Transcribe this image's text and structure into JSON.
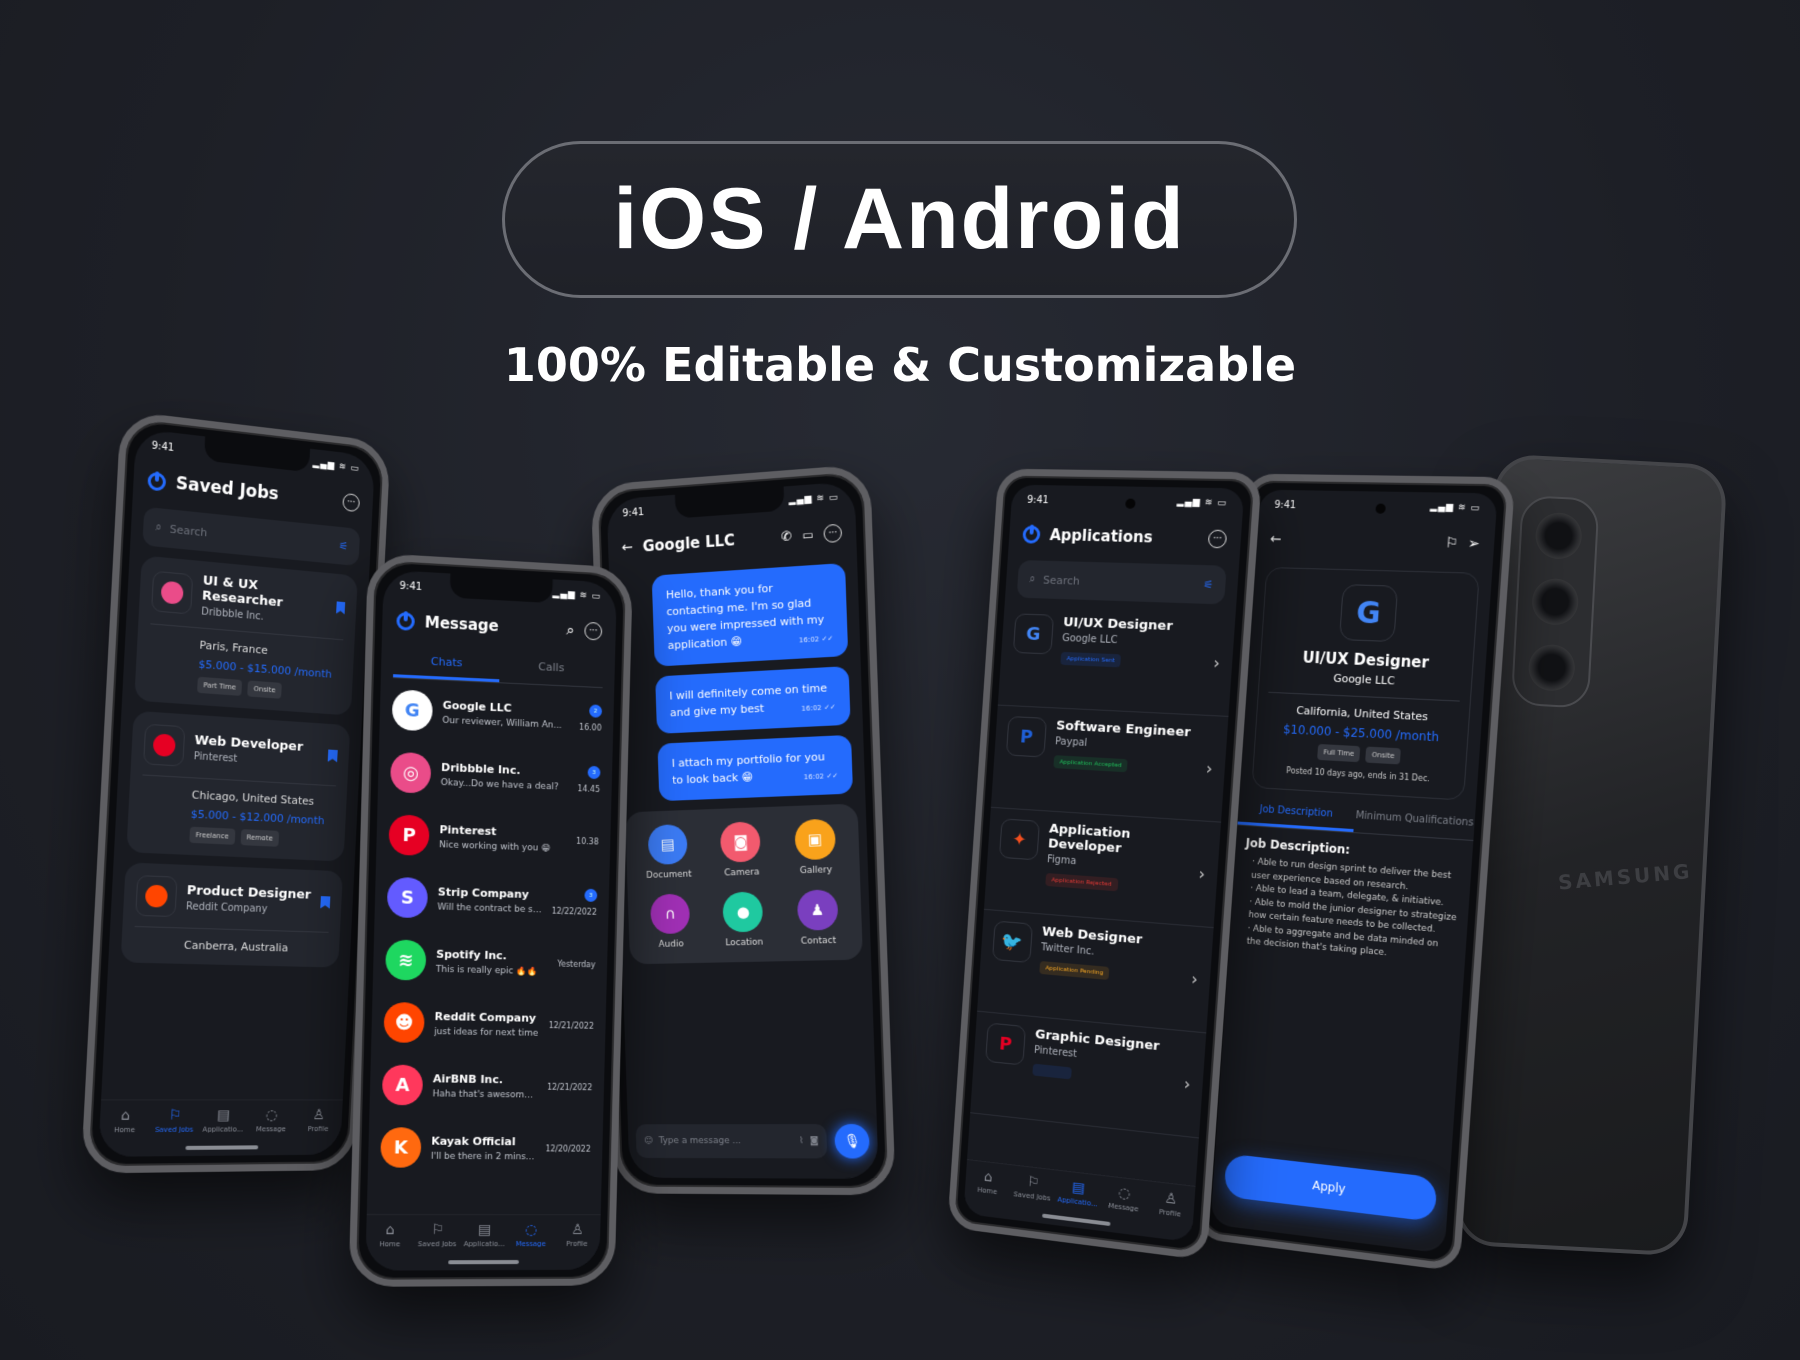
{
  "hero": {
    "title": "iOS / Android",
    "subtitle": "100% Editable & Customizable"
  },
  "colors": {
    "accent": "#246bfd",
    "background": "#1d1f26",
    "card": "#23262e"
  },
  "saved_jobs": {
    "time": "9:41",
    "title": "Saved Jobs",
    "search_placeholder": "Search",
    "jobs": [
      {
        "title": "UI & UX Researcher",
        "company": "Dribbble Inc.",
        "location": "Paris, France",
        "salary": "$5.000 - $15.000 /month",
        "tags": [
          "Part Time",
          "Onsite"
        ],
        "logo_color": "#ea4c89",
        "logo_icon": "dribbble-icon"
      },
      {
        "title": "Web Developer",
        "company": "Pinterest",
        "location": "Chicago, United States",
        "salary": "$5.000 - $12.000 /month",
        "tags": [
          "Freelance",
          "Remote"
        ],
        "logo_color": "#e60023",
        "logo_icon": "pinterest-icon"
      },
      {
        "title": "Product Designer",
        "company": "Reddit Company",
        "location": "Canberra, Australia",
        "salary": "",
        "tags": [],
        "logo_color": "#ff4500",
        "logo_icon": "reddit-icon"
      }
    ],
    "nav": [
      "Home",
      "Saved Jobs",
      "Applicatio...",
      "Message",
      "Profile"
    ],
    "nav_active": 1
  },
  "message": {
    "time": "9:41",
    "title": "Message",
    "tabs": [
      "Chats",
      "Calls"
    ],
    "chats": [
      {
        "name": "Google LLC",
        "preview": "Our reviewer, William An...",
        "time": "16.00",
        "badge": "2",
        "color": "#ffffff",
        "letter": "G"
      },
      {
        "name": "Dribbble Inc.",
        "preview": "Okay...Do we have a deal?",
        "time": "14.45",
        "badge": "3",
        "color": "#ea4c89",
        "letter": "◎"
      },
      {
        "name": "Pinterest",
        "preview": "Nice working with you 😁",
        "time": "10.38",
        "badge": "",
        "color": "#e60023",
        "letter": "P"
      },
      {
        "name": "Strip Company",
        "preview": "Will the contract be sent?",
        "time": "12/22/2022",
        "badge": "3",
        "color": "#635bff",
        "letter": "S"
      },
      {
        "name": "Spotify Inc.",
        "preview": "This is really epic 🔥🔥",
        "time": "Yesterday",
        "badge": "",
        "color": "#1ed760",
        "letter": "≋"
      },
      {
        "name": "Reddit Company",
        "preview": "just ideas for next time",
        "time": "12/21/2022",
        "badge": "",
        "color": "#ff4500",
        "letter": "☻"
      },
      {
        "name": "AirBNB Inc.",
        "preview": "Haha that's awesome! 😂",
        "time": "12/21/2022",
        "badge": "",
        "color": "#ff385c",
        "letter": "A"
      },
      {
        "name": "Kayak Official",
        "preview": "I'll be there in 2 mins ⏰",
        "time": "12/20/2022",
        "badge": "",
        "color": "#ff690f",
        "letter": "K"
      }
    ],
    "nav": [
      "Home",
      "Saved Jobs",
      "Applicatio...",
      "Message",
      "Profile"
    ],
    "nav_active": 3
  },
  "chat": {
    "time": "9:41",
    "title": "Google LLC",
    "messages": [
      {
        "text": "Hello, thank you for contacting me. I'm so glad you were impressed with my application 😁",
        "time": "16:02 ✓✓"
      },
      {
        "text": "I will definitely come on time and give my best",
        "time": "16:02 ✓✓"
      },
      {
        "text": "I attach my portfolio for you to look back 😁",
        "time": "16:02 ✓✓"
      }
    ],
    "attachments": [
      {
        "label": "Document",
        "color": "#3b7bf5",
        "icon": "▤"
      },
      {
        "label": "Camera",
        "color": "#f25a6e",
        "icon": "◙"
      },
      {
        "label": "Gallery",
        "color": "#f9a21b",
        "icon": "▣"
      },
      {
        "label": "Audio",
        "color": "#a02fb5",
        "icon": "∩"
      },
      {
        "label": "Location",
        "color": "#1fc9a0",
        "icon": "●"
      },
      {
        "label": "Contact",
        "color": "#7a3fbf",
        "icon": "♟"
      }
    ],
    "input_placeholder": "Type a message ..."
  },
  "applications": {
    "time": "9:41",
    "title": "Applications",
    "search_placeholder": "Search",
    "items": [
      {
        "title": "UI/UX Designer",
        "company": "Google LLC",
        "status": "Application Sent",
        "status_color": "#246bfd",
        "logo": "G",
        "logo_color": "#4285f4"
      },
      {
        "title": "Software Engineer",
        "company": "Paypal",
        "status": "Application Accepted",
        "status_color": "#1fbf5a",
        "logo": "P",
        "logo_color": "#1f5fd6"
      },
      {
        "title": "Application Developer",
        "company": "Figma",
        "status": "Application Rejected",
        "status_color": "#e53935",
        "logo": "✦",
        "logo_color": "#f24e1e"
      },
      {
        "title": "Web Designer",
        "company": "Twitter Inc.",
        "status": "Application Pending",
        "status_color": "#f5a623",
        "logo": "🐦",
        "logo_color": "#1da1f2"
      },
      {
        "title": "Graphic Designer",
        "company": "Pinterest",
        "status": "",
        "status_color": "#246bfd",
        "logo": "P",
        "logo_color": "#e60023"
      }
    ],
    "nav": [
      "Home",
      "Saved Jobs",
      "Applicatio...",
      "Message",
      "Profile"
    ],
    "nav_active": 2
  },
  "job_detail": {
    "time": "9:41",
    "title": "UI/UX Designer",
    "company": "Google LLC",
    "location": "California, United States",
    "salary": "$10.000 - $25.000 /month",
    "tags": [
      "Full Time",
      "Onsite"
    ],
    "posted": "Posted 10 days ago, ends in 31 Dec.",
    "tabs": [
      "Job Description",
      "Minimum Qualifications"
    ],
    "section_title": "Job Description:",
    "bullets": [
      "Able to run design sprint to deliver the best user experience based on research.",
      "Able to lead a team, delegate, & initiative.",
      "Able to mold the junior designer to strategize how certain feature needs to be collected.",
      "Able to aggregate and be data minded on the decision that's taking place."
    ],
    "apply_label": "Apply"
  },
  "device_back": {
    "brand": "SAMSUNG"
  }
}
